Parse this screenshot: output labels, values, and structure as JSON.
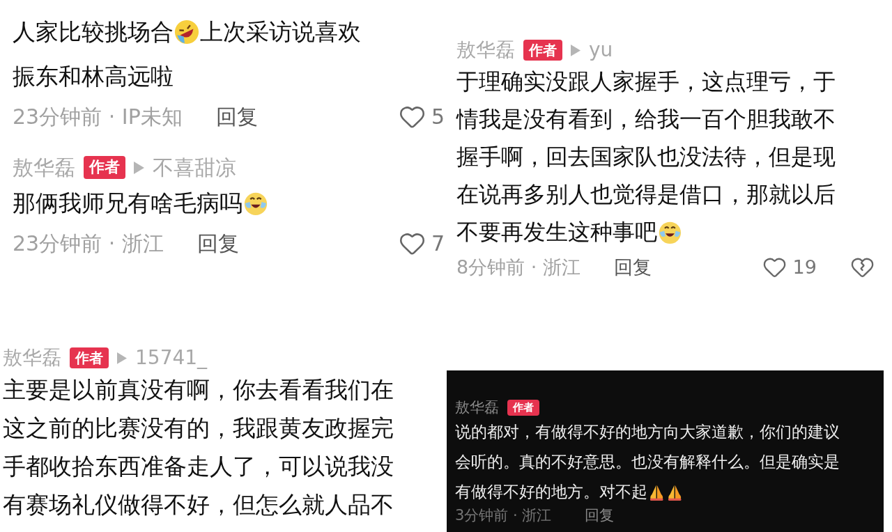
{
  "panels": [
    {
      "kind": "light",
      "comments": [
        {
          "lines": [
            [
              {
                "kind": "text",
                "text": "人家比较挑场合"
              },
              {
                "kind": "rofl-emoji"
              },
              {
                "kind": "text",
                "text": "上次采访说喜欢"
              }
            ],
            [
              {
                "kind": "text",
                "text": "振东和林高远啦"
              }
            ]
          ],
          "time": "23分钟前 · IP未知",
          "reply": "回复",
          "likes": "5"
        },
        {
          "author": "敖华磊",
          "badge": "作者",
          "reply_to": "不喜甜凉",
          "lines": [
            [
              {
                "kind": "text",
                "text": "那俩我师兄有啥毛病吗"
              },
              {
                "kind": "crying-laugh-emoji"
              }
            ]
          ],
          "time": "23分钟前 · 浙江",
          "reply": "回复",
          "likes": "7"
        }
      ]
    },
    {
      "kind": "light",
      "comments": [
        {
          "author": "敖华磊",
          "badge": "作者",
          "reply_to": "yu",
          "lines": [
            [
              {
                "kind": "text",
                "text": "于理确实没跟人家握手，这点理亏，于"
              }
            ],
            [
              {
                "kind": "text",
                "text": "情我是没有看到，给我一百个胆我敢不"
              }
            ],
            [
              {
                "kind": "text",
                "text": "握手啊，回去国家队也没法待，但是现"
              }
            ],
            [
              {
                "kind": "text",
                "text": "在说再多别人也觉得是借口，那就以后"
              }
            ],
            [
              {
                "kind": "text",
                "text": "不要再发生这种事吧"
              },
              {
                "kind": "crying-laugh-emoji"
              }
            ]
          ],
          "time": "8分钟前 · 浙江",
          "reply": "回复",
          "likes": "19",
          "dislike": true
        }
      ]
    },
    {
      "kind": "light",
      "comments": [
        {
          "author": "敖华磊",
          "badge": "作者",
          "reply_to": "15741_",
          "lines": [
            [
              {
                "kind": "text",
                "text": "主要是以前真没有啊，你去看看我们在"
              }
            ],
            [
              {
                "kind": "text",
                "text": "这之前的比赛没有的，我跟黄友政握完"
              }
            ],
            [
              {
                "kind": "text",
                "text": "手都收拾东西准备走人了，可以说我没"
              }
            ],
            [
              {
                "kind": "text",
                "text": "有赛场礼仪做得不好，但怎么就人品不"
              }
            ]
          ]
        }
      ]
    },
    {
      "kind": "dark",
      "comments": [
        {
          "author": "敖华磊",
          "badge": "作者",
          "lines": [
            [
              {
                "kind": "text",
                "text": "说的都对，有做得不好的地方向大家道歉，你们的建议"
              }
            ],
            [
              {
                "kind": "text",
                "text": "会听的。真的不好意思。也没有解释什么。但是确实是"
              }
            ],
            [
              {
                "kind": "text",
                "text": "有做得不好的地方。对不起"
              },
              {
                "kind": "pray-emoji"
              },
              {
                "kind": "pray-emoji"
              }
            ]
          ],
          "time": "3分钟前 · 浙江",
          "reply": "回复"
        }
      ]
    }
  ]
}
